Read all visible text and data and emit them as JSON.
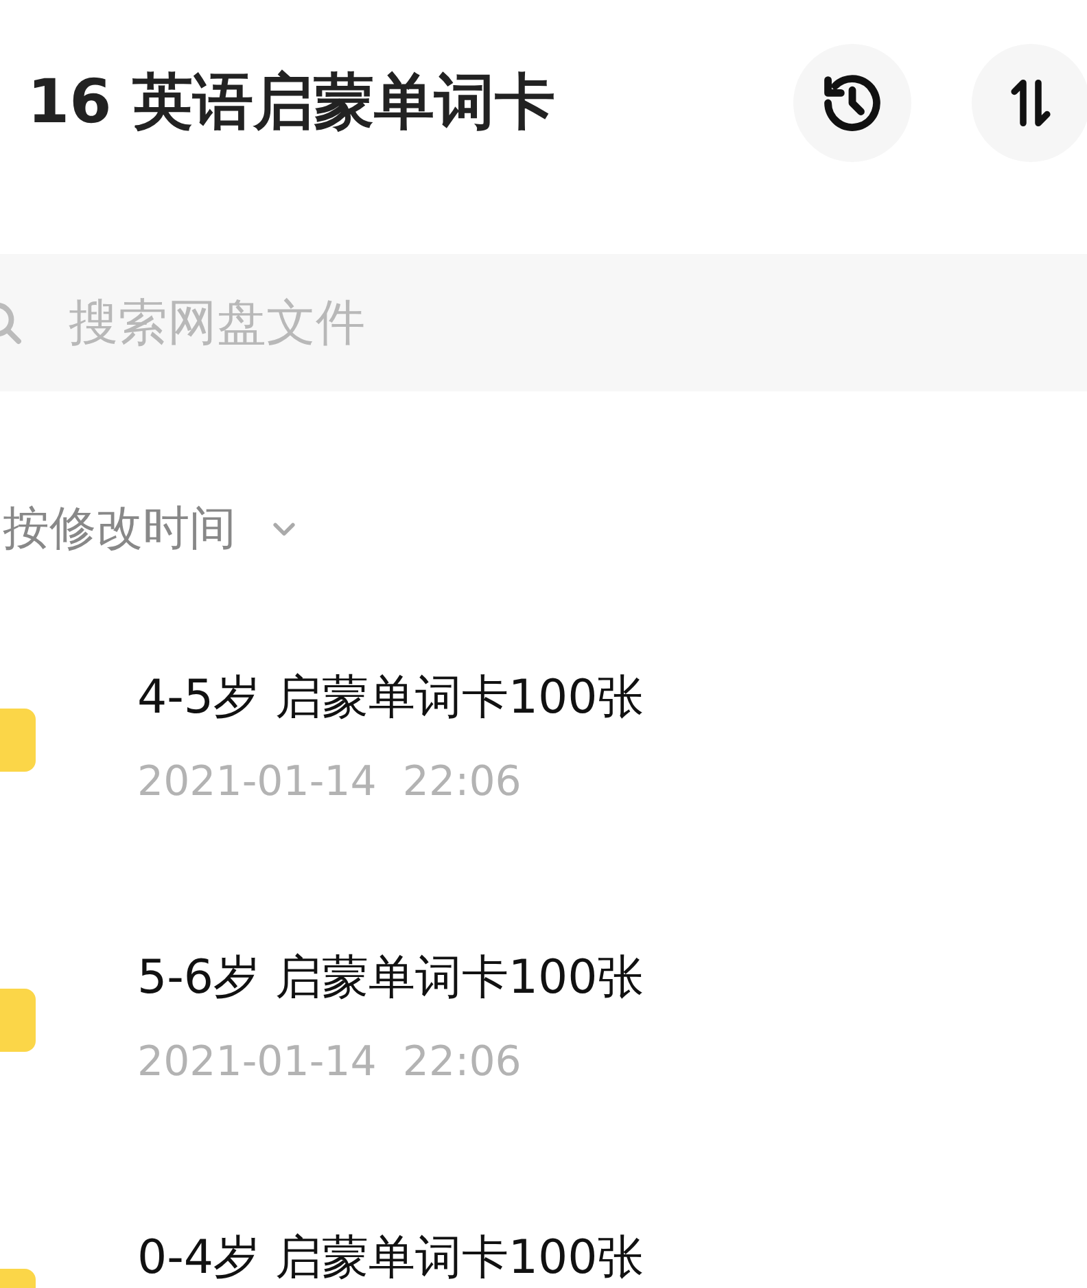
{
  "header": {
    "title": "16 英语启蒙单词卡"
  },
  "search": {
    "placeholder": "搜索网盘文件"
  },
  "sort": {
    "label": "按修改时间"
  },
  "files": [
    {
      "name": "4-5岁 启蒙单词卡100张",
      "modified": "2021-01-14  22:06"
    },
    {
      "name": "5-6岁 启蒙单词卡100张",
      "modified": "2021-01-14  22:06"
    },
    {
      "name": "0-4岁 启蒙单词卡100张"
    }
  ]
}
